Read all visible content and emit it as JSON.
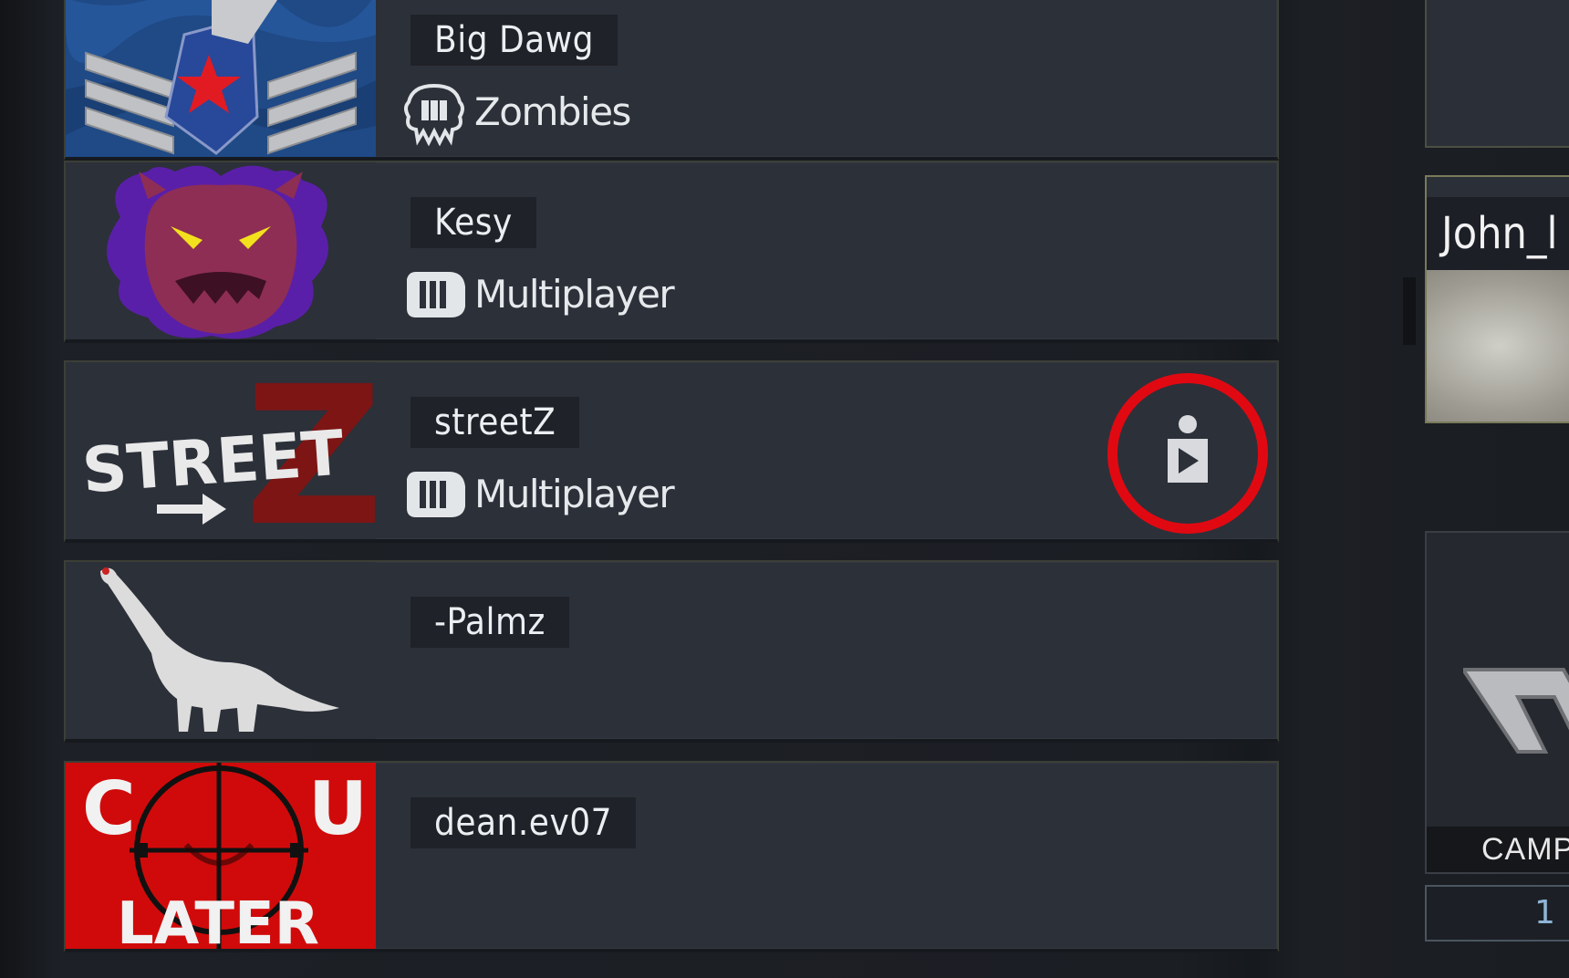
{
  "friends": [
    {
      "gamertag": "Big Dawg",
      "mode": "Zombies",
      "emblem": "sergeant-rank-emblem"
    },
    {
      "gamertag": "Kesy",
      "mode": "Multiplayer",
      "emblem": "purple-demon-emblem"
    },
    {
      "gamertag": "streetZ",
      "mode": "Multiplayer",
      "emblem": "street-z-emblem",
      "join_icon": "join-game-icon"
    },
    {
      "gamertag": "-Palmz",
      "mode": "",
      "emblem": "dinosaur-emblem"
    },
    {
      "gamertag": "dean.ev07",
      "mode": "",
      "emblem": "c-u-later-emblem"
    }
  ],
  "emblem_text": {
    "street": "STREET",
    "z": "Z",
    "c": "C",
    "u": "U",
    "later": "LATER"
  },
  "right_panel": {
    "player_name": "John_l",
    "campaign_label": "CAMPA",
    "count": "1"
  },
  "colors": {
    "row_bg": "#2c3039",
    "highlight_ring": "#e00912",
    "campaign_count": "#8fb4d6"
  }
}
